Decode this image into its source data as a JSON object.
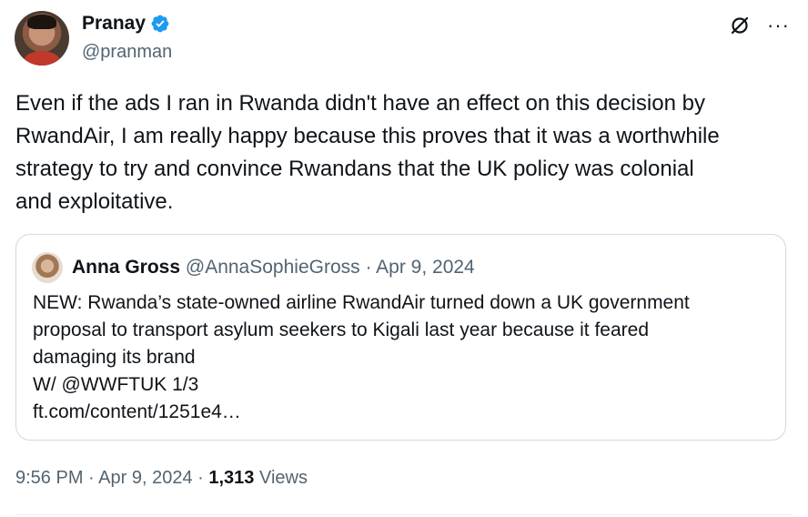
{
  "author": {
    "name": "Pranay",
    "handle": "@pranman",
    "verified_color": "#1d9bf0"
  },
  "icons": {
    "verified": "verified-badge-icon",
    "grok": "grok-icon",
    "more": "more-options-icon"
  },
  "tweet": {
    "text": "Even if the ads I ran in Rwanda didn't have an effect on this decision by\nRwandAir, I am really happy because this proves that it was a worthwhile\nstrategy to try and convince Rwandans that the UK policy was colonial\nand exploitative."
  },
  "quoted": {
    "name": "Anna Gross",
    "handle": "@AnnaSophieGross",
    "date": "Apr 9, 2024",
    "text": "NEW: Rwanda’s state-owned airline RwandAir turned down a UK government\nproposal to transport asylum seekers to Kigali last year because it feared\ndamaging its brand\nW/ @WWFTUK 1/3\nft.com/content/1251e4…"
  },
  "footer": {
    "time": "9:56 PM",
    "date": "Apr 9, 2024",
    "views_count": "1,313",
    "views_label": "Views"
  }
}
